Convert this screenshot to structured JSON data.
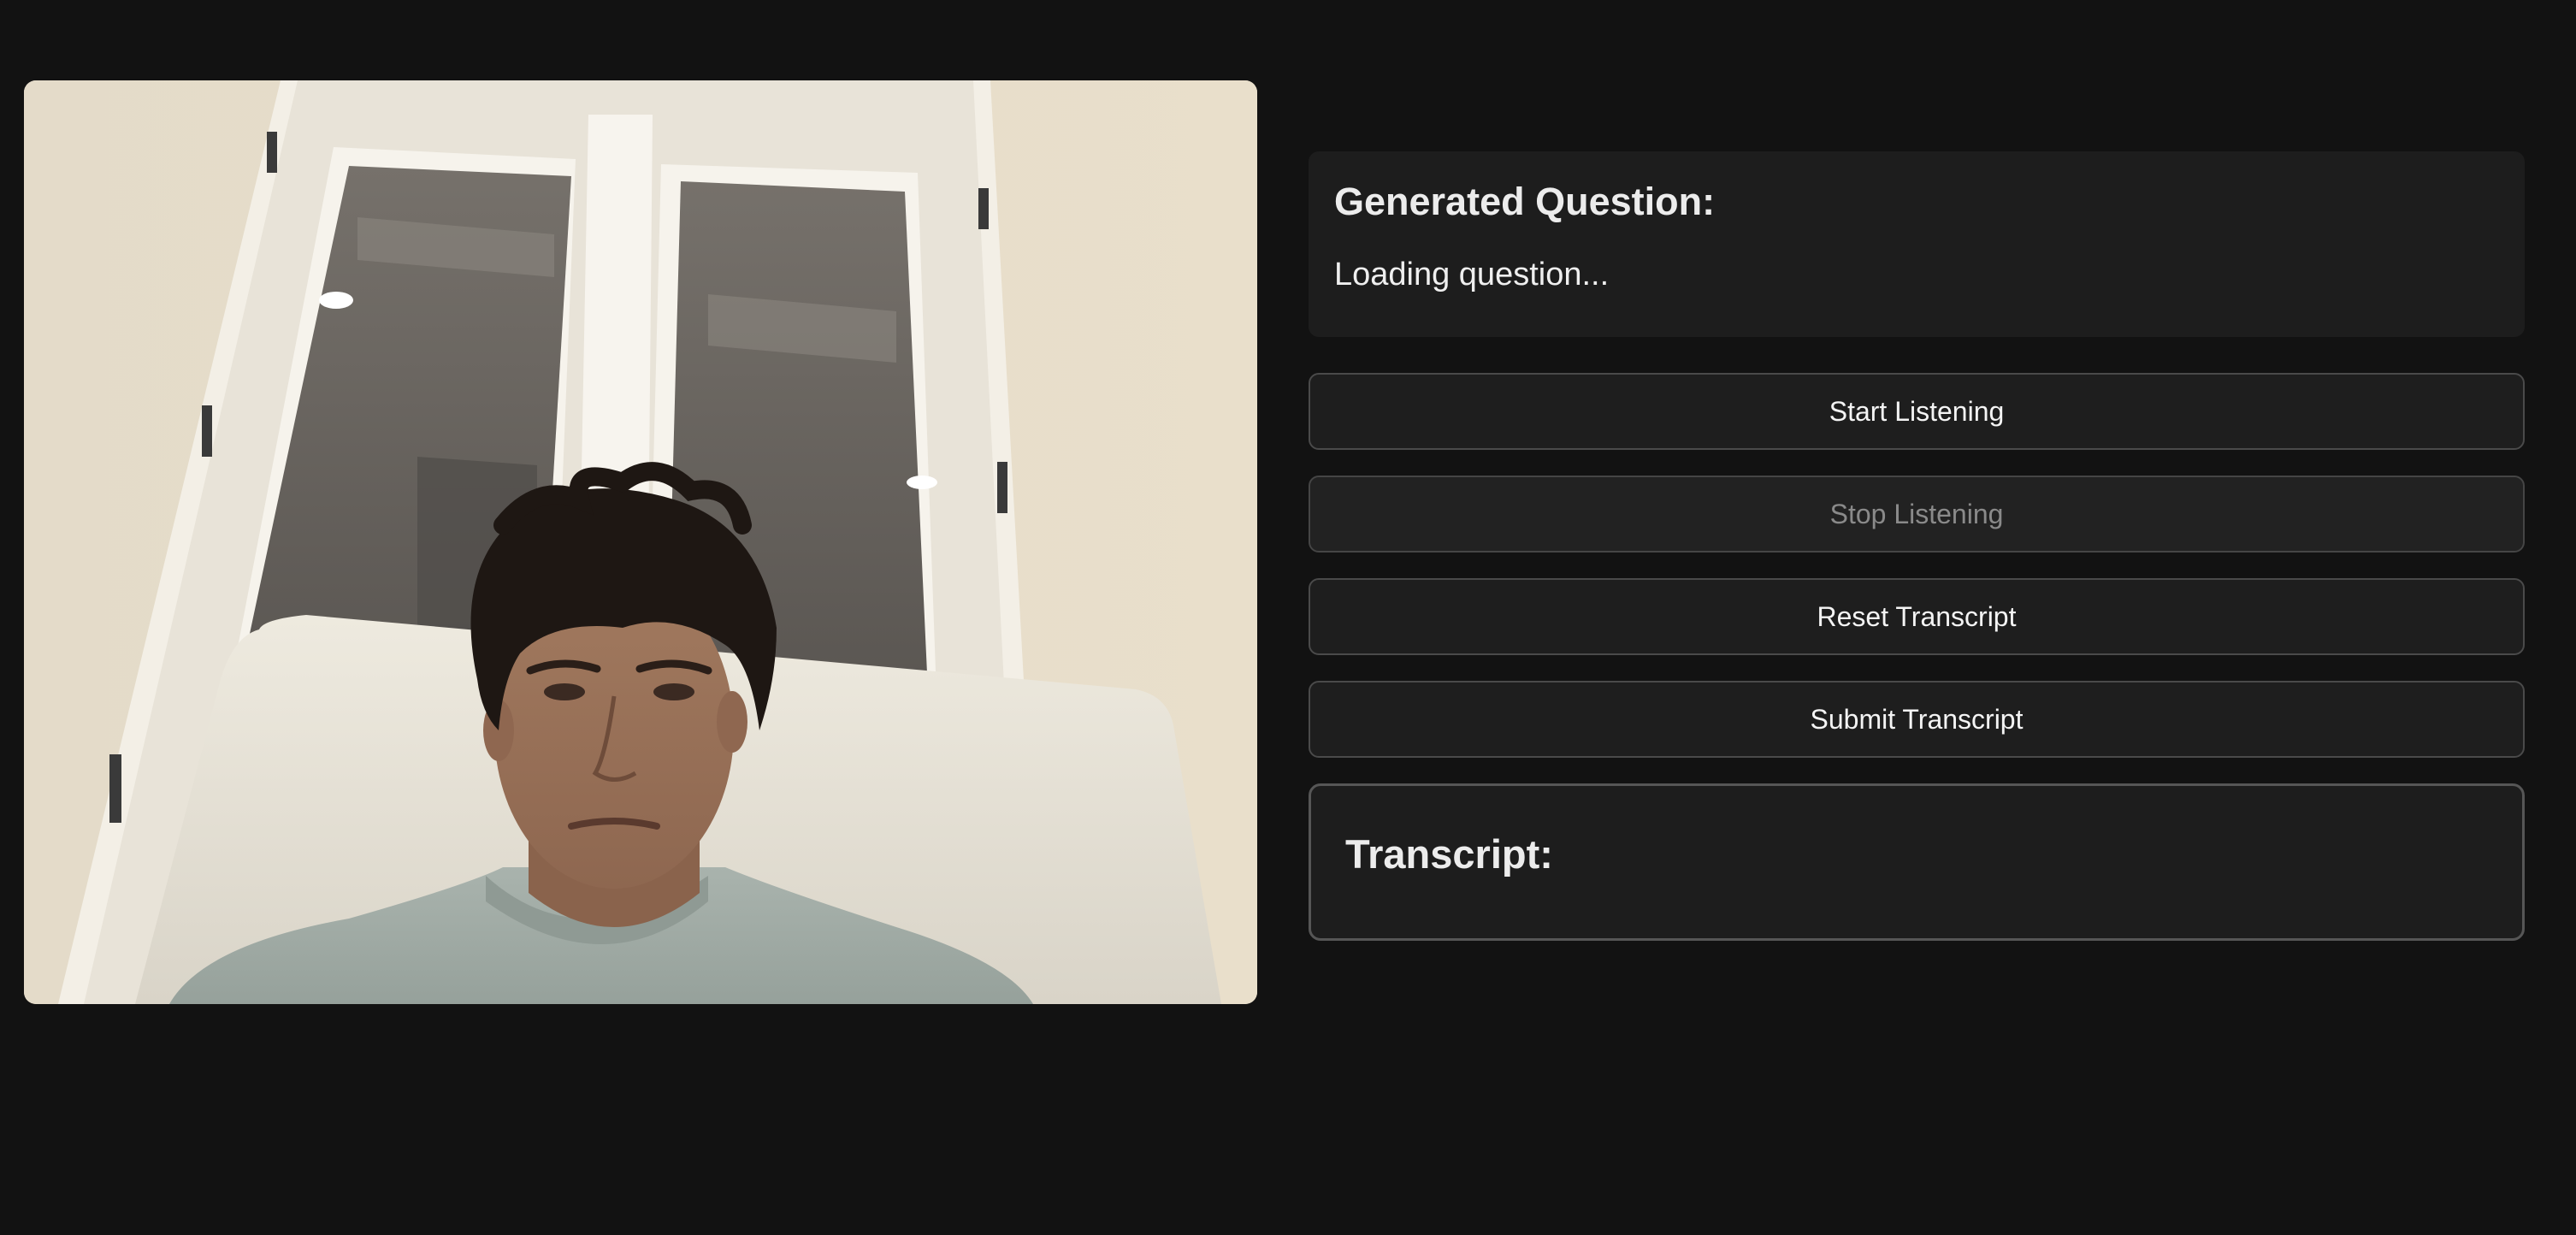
{
  "video": {
    "description_icon": "webcam-feed"
  },
  "question": {
    "title": "Generated Question:",
    "text": "Loading question..."
  },
  "controls": {
    "start_label": "Start Listening",
    "stop_label": "Stop Listening",
    "reset_label": "Reset Transcript",
    "submit_label": "Submit Transcript"
  },
  "transcript": {
    "title": "Transcript:",
    "text": ""
  },
  "colors": {
    "background": "#121212",
    "card": "#1d1d1d",
    "button_border": "#4a4a4a",
    "disabled_text": "#8a8a8a"
  }
}
